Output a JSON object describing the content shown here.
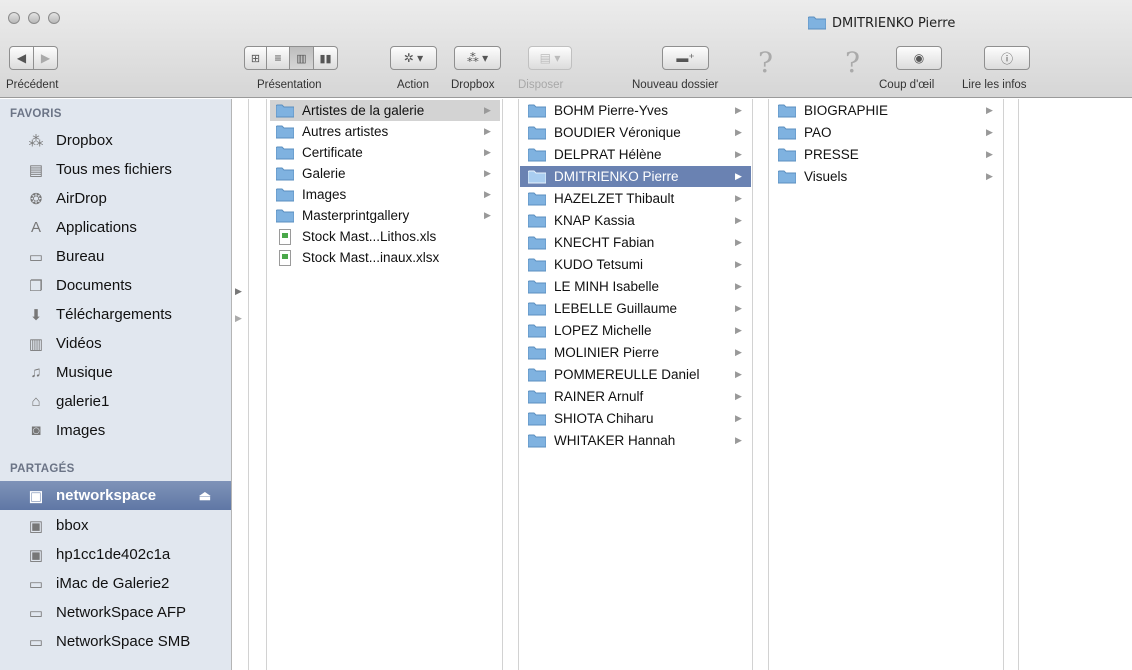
{
  "window": {
    "title": "DMITRIENKO Pierre"
  },
  "toolbar": {
    "back_label": "Précédent",
    "view_label": "Présentation",
    "action_label": "Action",
    "dropbox_label": "Dropbox",
    "arrange_label": "Disposer",
    "new_folder_label": "Nouveau dossier",
    "quicklook_label": "Coup d'œil",
    "info_label": "Lire les infos",
    "help_glyph": "?"
  },
  "sidebar": {
    "favorites_header": "FAVORIS",
    "favorites": [
      {
        "label": "Dropbox",
        "icon": "dropbox-icon"
      },
      {
        "label": "Tous mes fichiers",
        "icon": "all-files-icon"
      },
      {
        "label": "AirDrop",
        "icon": "airdrop-icon"
      },
      {
        "label": "Applications",
        "icon": "applications-icon"
      },
      {
        "label": "Bureau",
        "icon": "desktop-icon"
      },
      {
        "label": "Documents",
        "icon": "documents-icon"
      },
      {
        "label": "Téléchargements",
        "icon": "downloads-icon"
      },
      {
        "label": "Vidéos",
        "icon": "movies-icon"
      },
      {
        "label": "Musique",
        "icon": "music-icon"
      },
      {
        "label": "galerie1",
        "icon": "home-icon"
      },
      {
        "label": "Images",
        "icon": "pictures-icon"
      }
    ],
    "shared_header": "PARTAGÉS",
    "shared": [
      {
        "label": "networkspace",
        "icon": "server-icon",
        "selected": true
      },
      {
        "label": "bbox",
        "icon": "server-icon"
      },
      {
        "label": "hp1cc1de402c1a",
        "icon": "server-icon"
      },
      {
        "label": "iMac de Galerie2",
        "icon": "imac-icon"
      },
      {
        "label": "NetworkSpace AFP",
        "icon": "imac-icon"
      },
      {
        "label": "NetworkSpace SMB",
        "icon": "imac-icon"
      }
    ]
  },
  "columns": {
    "col1": [
      {
        "label": "Artistes de la galerie",
        "type": "folder",
        "selected": "grey"
      },
      {
        "label": "Autres artistes",
        "type": "folder"
      },
      {
        "label": "Certificate",
        "type": "folder"
      },
      {
        "label": "Galerie",
        "type": "folder"
      },
      {
        "label": "Images",
        "type": "folder"
      },
      {
        "label": "Masterprintgallery",
        "type": "folder"
      },
      {
        "label": "Stock Mast...Lithos.xls",
        "type": "file"
      },
      {
        "label": "Stock Mast...inaux.xlsx",
        "type": "file"
      }
    ],
    "col2": [
      {
        "label": "BOHM Pierre-Yves"
      },
      {
        "label": "BOUDIER Véronique"
      },
      {
        "label": "DELPRAT Hélène"
      },
      {
        "label": "DMITRIENKO Pierre",
        "selected": "blue"
      },
      {
        "label": "HAZELZET Thibault"
      },
      {
        "label": "KNAP Kassia"
      },
      {
        "label": "KNECHT Fabian"
      },
      {
        "label": "KUDO Tetsumi"
      },
      {
        "label": "LE MINH Isabelle"
      },
      {
        "label": "LEBELLE Guillaume"
      },
      {
        "label": "LOPEZ Michelle"
      },
      {
        "label": "MOLINIER Pierre"
      },
      {
        "label": "POMMEREULLE Daniel"
      },
      {
        "label": "RAINER Arnulf"
      },
      {
        "label": "SHIOTA Chiharu"
      },
      {
        "label": "WHITAKER Hannah"
      }
    ],
    "col3": [
      {
        "label": "BIOGRAPHIE"
      },
      {
        "label": "PAO"
      },
      {
        "label": "PRESSE"
      },
      {
        "label": "Visuels"
      }
    ]
  },
  "colors": {
    "selection_blue": "#6a82b2",
    "selection_grey": "#d3d3d3",
    "sidebar_bg": "#e1e7ef",
    "folder_blue": "#7fb2e0"
  }
}
